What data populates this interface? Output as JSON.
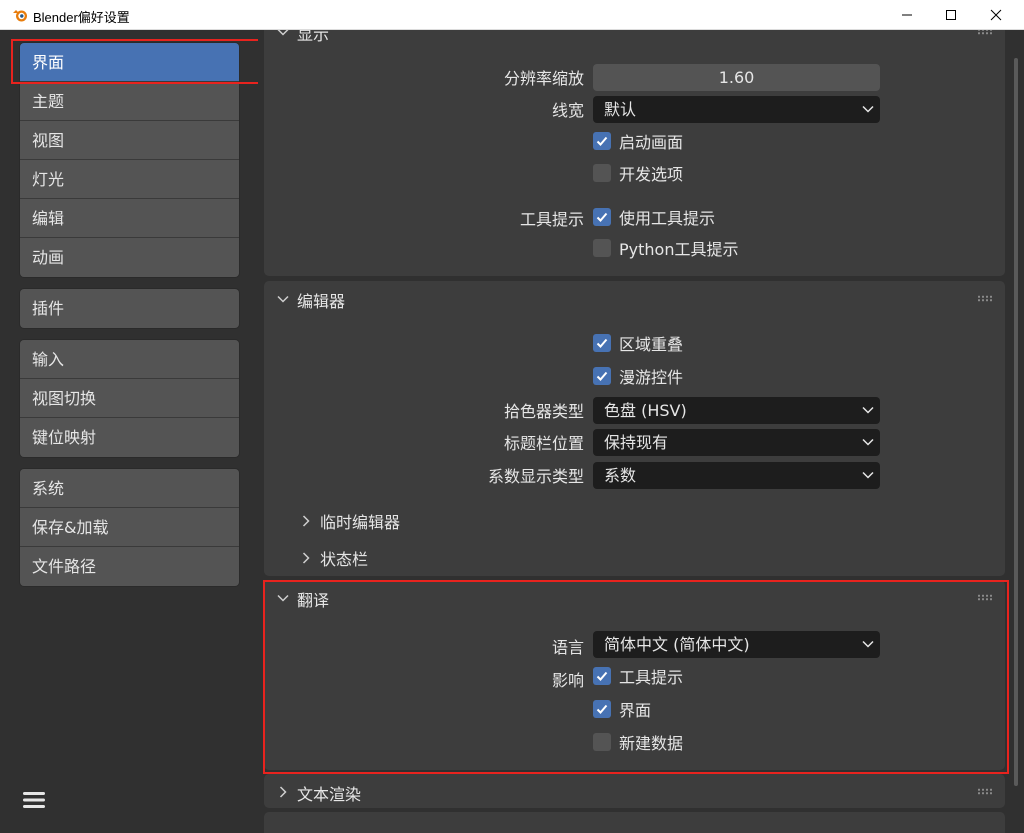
{
  "window": {
    "title": "Blender偏好设置"
  },
  "sidebar": {
    "groups": [
      {
        "items": [
          {
            "label": "界面"
          },
          {
            "label": "主题"
          },
          {
            "label": "视图"
          },
          {
            "label": "灯光"
          },
          {
            "label": "编辑"
          },
          {
            "label": "动画"
          }
        ]
      },
      {
        "items": [
          {
            "label": "插件"
          }
        ]
      },
      {
        "items": [
          {
            "label": "输入"
          },
          {
            "label": "视图切换"
          },
          {
            "label": "键位映射"
          }
        ]
      },
      {
        "items": [
          {
            "label": "系统"
          },
          {
            "label": "保存&加载"
          },
          {
            "label": "文件路径"
          }
        ]
      }
    ],
    "active": "界面"
  },
  "display": {
    "title": "显示",
    "resolution_label": "分辨率缩放",
    "resolution_value": "1.60",
    "line_width_label": "线宽",
    "line_width_value": "默认",
    "splash_label": "启动画面",
    "splash_checked": true,
    "dev_label": "开发选项",
    "dev_checked": false,
    "tooltips_label": "工具提示",
    "use_tooltips_label": "使用工具提示",
    "use_tooltips_checked": true,
    "python_tooltips_label": "Python工具提示",
    "python_tooltips_checked": false
  },
  "editors": {
    "title": "编辑器",
    "region_overlap_label": "区域重叠",
    "region_overlap_checked": true,
    "navigation_controls_label": "漫游控件",
    "navigation_controls_checked": true,
    "color_picker_label": "拾色器类型",
    "color_picker_value": "色盘 (HSV)",
    "header_pos_label": "标题栏位置",
    "header_pos_value": "保持现有",
    "factor_display_label": "系数显示类型",
    "factor_display_value": "系数",
    "temp_editors_label": "临时编辑器",
    "status_bar_label": "状态栏"
  },
  "translation": {
    "title": "翻译",
    "language_label": "语言",
    "language_value": "简体中文 (简体中文)",
    "affect_label": "影响",
    "tooltips_label": "工具提示",
    "tooltips_checked": true,
    "interface_label": "界面",
    "interface_checked": true,
    "new_data_label": "新建数据",
    "new_data_checked": false
  },
  "text_rendering": {
    "title": "文本渲染"
  },
  "colors": {
    "accent": "#4772b3",
    "panel": "#3d3d3d",
    "background": "#303030",
    "highlight_box": "#e8231e"
  }
}
